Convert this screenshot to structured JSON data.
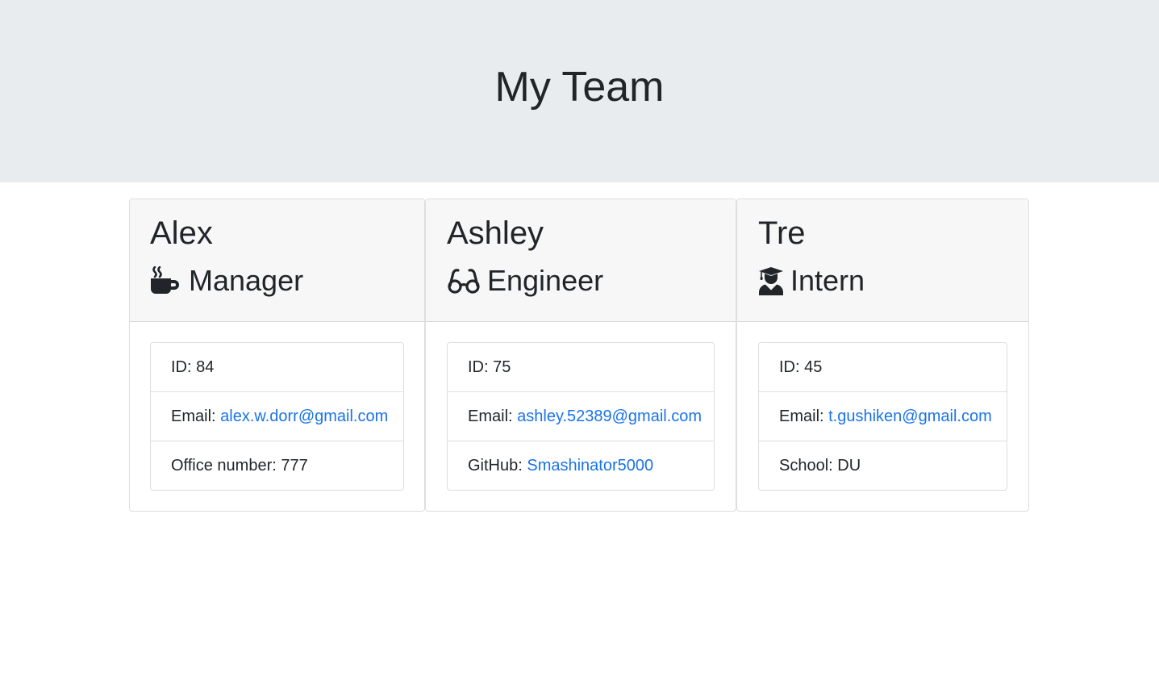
{
  "header": {
    "title": "My Team"
  },
  "colors": {
    "header_background": "#e9ecef",
    "card_header_background": "#f7f7f7",
    "link": "#1a73e8",
    "text": "#212529"
  },
  "employees": [
    {
      "name": "Alex",
      "role": "Manager",
      "role_icon": "mug-hot-icon",
      "id_label": "ID: ",
      "id": "84",
      "email_label": "Email: ",
      "email": "alex.w.dorr@gmail.com",
      "extra_label": "Office number: ",
      "extra_value": "777"
    },
    {
      "name": "Ashley",
      "role": "Engineer",
      "role_icon": "glasses-icon",
      "id_label": "ID: ",
      "id": "75",
      "email_label": "Email: ",
      "email": "ashley.52389@gmail.com",
      "extra_label": "GitHub: ",
      "extra_value": "Smashinator5000"
    },
    {
      "name": "Tre",
      "role": "Intern",
      "role_icon": "user-graduate-icon",
      "id_label": "ID: ",
      "id": "45",
      "email_label": "Email: ",
      "email": "t.gushiken@gmail.com",
      "extra_label": "School: ",
      "extra_value": "DU"
    }
  ]
}
